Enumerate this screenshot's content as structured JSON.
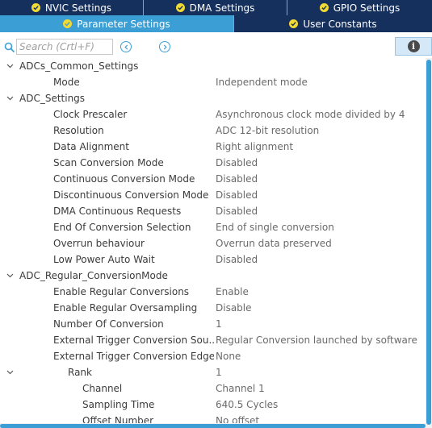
{
  "tabs_row1": [
    {
      "label": "NVIC Settings"
    },
    {
      "label": "DMA Settings"
    },
    {
      "label": "GPIO Settings"
    }
  ],
  "tabs_row2": [
    {
      "label": "Parameter Settings",
      "active": true
    },
    {
      "label": "User Constants",
      "active": false
    }
  ],
  "search": {
    "placeholder": "Search (Crtl+F)"
  },
  "colors": {
    "tab_bg": "#16305e",
    "tab_active": "#3b9fd6",
    "check_dot": "#f2d933",
    "accent": "#3b9fd6"
  },
  "tree": [
    {
      "type": "group",
      "label": "ADCs_Common_Settings",
      "expanded": true
    },
    {
      "type": "item",
      "label": "Mode",
      "value": "Independent mode"
    },
    {
      "type": "group",
      "label": "ADC_Settings",
      "expanded": true
    },
    {
      "type": "item",
      "label": "Clock Prescaler",
      "value": "Asynchronous clock mode divided by 4"
    },
    {
      "type": "item",
      "label": "Resolution",
      "value": "ADC 12-bit resolution"
    },
    {
      "type": "item",
      "label": "Data Alignment",
      "value": "Right alignment"
    },
    {
      "type": "item",
      "label": "Scan Conversion Mode",
      "value": "Disabled"
    },
    {
      "type": "item",
      "label": "Continuous Conversion Mode",
      "value": "Disabled"
    },
    {
      "type": "item",
      "label": "Discontinuous Conversion Mode",
      "value": "Disabled"
    },
    {
      "type": "item",
      "label": "DMA Continuous Requests",
      "value": "Disabled"
    },
    {
      "type": "item",
      "label": "End Of Conversion Selection",
      "value": "End of single conversion"
    },
    {
      "type": "item",
      "label": "Overrun behaviour",
      "value": "Overrun data preserved"
    },
    {
      "type": "item",
      "label": "Low Power Auto Wait",
      "value": "Disabled"
    },
    {
      "type": "group",
      "label": "ADC_Regular_ConversionMode",
      "expanded": true
    },
    {
      "type": "item",
      "label": "Enable Regular Conversions",
      "value": "Enable"
    },
    {
      "type": "item",
      "label": "Enable Regular Oversampling",
      "value": "Disable"
    },
    {
      "type": "item",
      "label": "Number Of Conversion",
      "value": "1"
    },
    {
      "type": "item",
      "label": "External Trigger Conversion Sou...",
      "value": "Regular Conversion launched by software"
    },
    {
      "type": "item",
      "label": "External Trigger Conversion Edge",
      "value": "None"
    },
    {
      "type": "subgroup",
      "label": "Rank",
      "value": "1",
      "expanded": true
    },
    {
      "type": "subitem",
      "label": "Channel",
      "value": "Channel 1"
    },
    {
      "type": "subitem",
      "label": "Sampling Time",
      "value": "640.5 Cycles"
    },
    {
      "type": "subitem",
      "label": "Offset Number",
      "value": "No offset"
    }
  ]
}
